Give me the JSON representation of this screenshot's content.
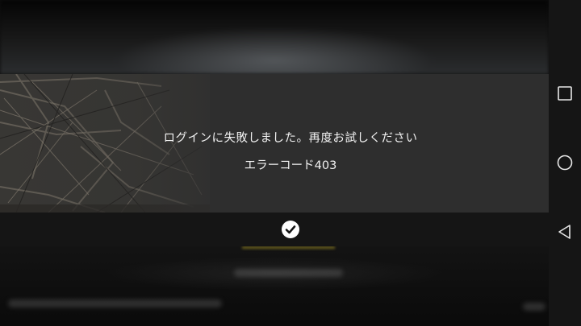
{
  "dialog": {
    "message": "ログインに失敗しました。再度お試しください",
    "error_code": "エラーコード403",
    "confirm_icon": "check-circle-icon"
  },
  "navigation": {
    "recent_icon": "square-icon",
    "home_icon": "circle-icon",
    "back_icon": "triangle-back-icon"
  },
  "colors": {
    "dialog_background": "#2e2e2e",
    "footer_background": "#151515",
    "text": "#f2f2f2",
    "nav_background": "#151515"
  }
}
